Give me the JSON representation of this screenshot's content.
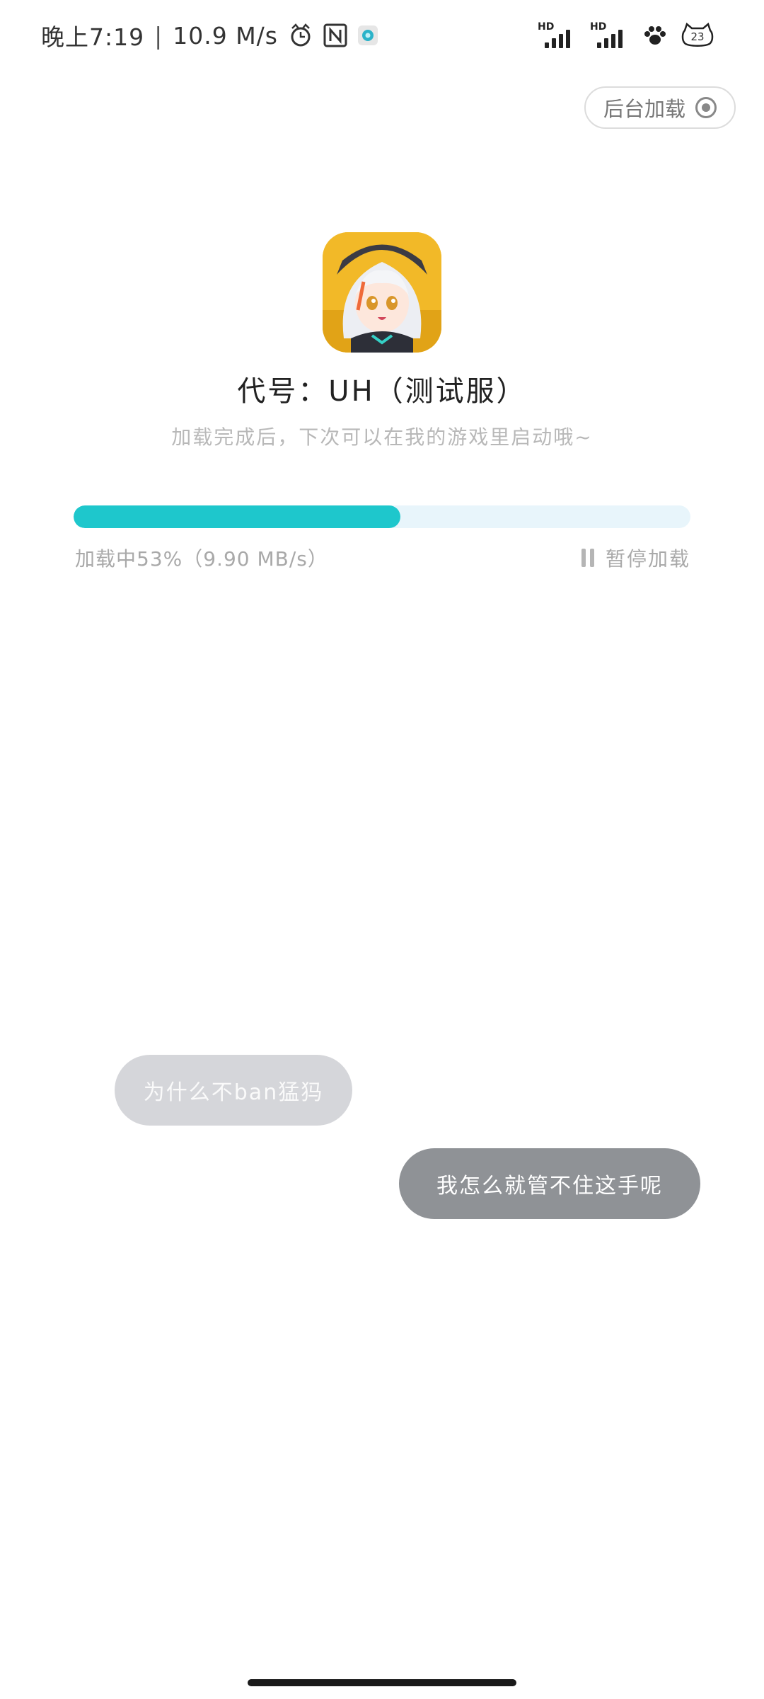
{
  "status_bar": {
    "time": "晚上7:19",
    "separator": "|",
    "net_speed": "10.9 M/s",
    "icons_left": [
      "cat-clock-icon",
      "nfc-icon",
      "app-notification-icon"
    ],
    "icons_right": [
      "hd-signal-1-icon",
      "hd-signal-2-icon",
      "paw-icon",
      "cat-battery-icon"
    ],
    "hd_label": "HD",
    "battery": "23"
  },
  "background_load": {
    "label": "后台加载",
    "icon": "target-icon"
  },
  "app": {
    "icon": "game-avatar-icon",
    "title": "代号：UH（测试服）",
    "subtitle": "加载完成后，下次可以在我的游戏里启动哦~"
  },
  "progress": {
    "fraction": 0.53,
    "status_text": "加载中53%（9.90  MB/s）",
    "fill_color": "#1ec7cc",
    "track_color": "#e8f5fb",
    "pause_label": "暂停加载"
  },
  "bubbles": {
    "left_text": "为什么不ban猛犸",
    "right_text": "我怎么就管不住这手呢"
  },
  "colors": {
    "accent": "#1ec7cc",
    "muted_text": "#a9a9a9"
  }
}
